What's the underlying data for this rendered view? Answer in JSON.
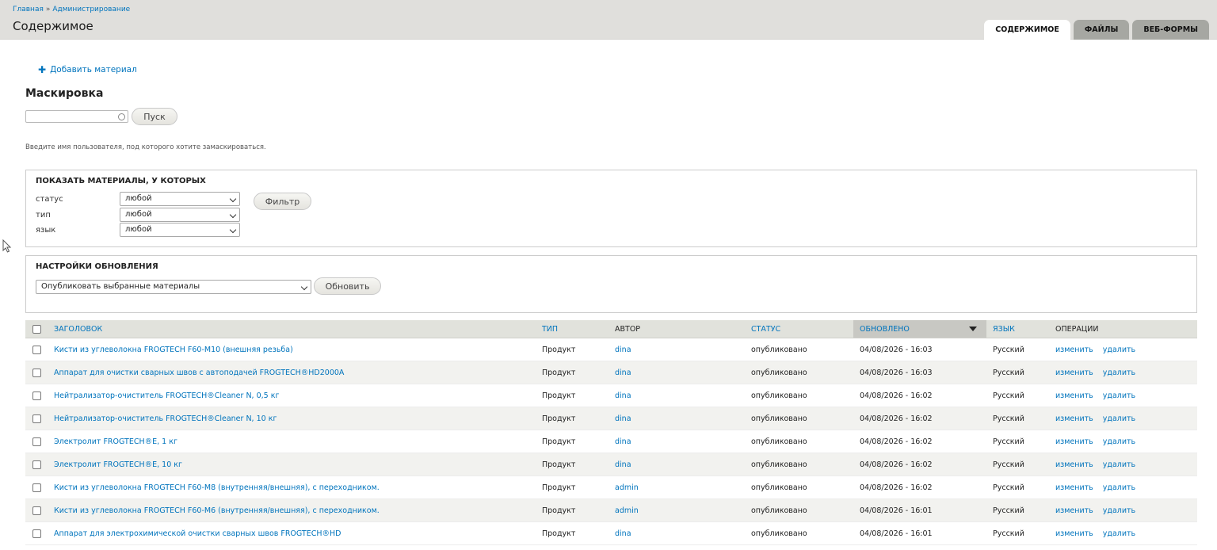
{
  "breadcrumb": {
    "items": [
      "Главная",
      "Администрирование"
    ],
    "sep": "»"
  },
  "page_title": "Содержимое",
  "tabs": [
    {
      "label": "СОДЕРЖИМОЕ",
      "active": true
    },
    {
      "label": "ФАЙЛЫ",
      "active": false
    },
    {
      "label": "ВЕБ-ФОРМЫ",
      "active": false
    }
  ],
  "add_link": {
    "icon": "plus-icon",
    "label": "Добавить материал"
  },
  "masquerade": {
    "title": "Маскировка",
    "input_value": "",
    "go_label": "Пуск",
    "description": "Введите имя пользователя, под которого хотите замаскироваться."
  },
  "filter": {
    "legend": "ПОКАЗАТЬ МАТЕРИАЛЫ, У КОТОРЫХ",
    "rows": [
      {
        "label": "статус",
        "value": "любой"
      },
      {
        "label": "тип",
        "value": "любой"
      },
      {
        "label": "язык",
        "value": "любой"
      }
    ],
    "button": "Фильтр"
  },
  "update": {
    "legend": "НАСТРОЙКИ ОБНОВЛЕНИЯ",
    "selected": "Опубликовать выбранные материалы",
    "button": "Обновить"
  },
  "table": {
    "headers": {
      "title": "ЗАГОЛОВОК",
      "type": "ТИП",
      "author": "АВТОР",
      "status": "СТАТУС",
      "updated": "ОБНОВЛЕНО",
      "lang": "ЯЗЫК",
      "ops": "ОПЕРАЦИИ"
    },
    "rows": [
      {
        "title": "Кисти из углеволокна FROGTECH F60-M10 (внешняя резьба)",
        "type": "Продукт",
        "author": "dina",
        "status": "опубликовано",
        "updated": "04/08/2026 - 16:03",
        "lang": "Русский",
        "edit": "изменить",
        "delete": "удалить"
      },
      {
        "title": "Аппарат для очистки сварных швов с автоподачей FROGTECH®HD2000A",
        "type": "Продукт",
        "author": "dina",
        "status": "опубликовано",
        "updated": "04/08/2026 - 16:03",
        "lang": "Русский",
        "edit": "изменить",
        "delete": "удалить"
      },
      {
        "title": "Нейтрализатор-очиститель FROGTECH®Cleaner N, 0,5 кг",
        "type": "Продукт",
        "author": "dina",
        "status": "опубликовано",
        "updated": "04/08/2026 - 16:02",
        "lang": "Русский",
        "edit": "изменить",
        "delete": "удалить"
      },
      {
        "title": "Нейтрализатор-очиститель FROGTECH®Cleaner N, 10 кг",
        "type": "Продукт",
        "author": "dina",
        "status": "опубликовано",
        "updated": "04/08/2026 - 16:02",
        "lang": "Русский",
        "edit": "изменить",
        "delete": "удалить"
      },
      {
        "title": "Электролит FROGTECH®E, 1 кг",
        "type": "Продукт",
        "author": "dina",
        "status": "опубликовано",
        "updated": "04/08/2026 - 16:02",
        "lang": "Русский",
        "edit": "изменить",
        "delete": "удалить"
      },
      {
        "title": "Электролит FROGTECH®E, 10 кг",
        "type": "Продукт",
        "author": "dina",
        "status": "опубликовано",
        "updated": "04/08/2026 - 16:02",
        "lang": "Русский",
        "edit": "изменить",
        "delete": "удалить"
      },
      {
        "title": "Кисти из углеволокна FROGTECH F60-M8 (внутренняя/внешняя), с переходником.",
        "type": "Продукт",
        "author": "admin",
        "status": "опубликовано",
        "updated": "04/08/2026 - 16:02",
        "lang": "Русский",
        "edit": "изменить",
        "delete": "удалить"
      },
      {
        "title": "Кисти из углеволокна FROGTECH F60-M6 (внутренняя/внешняя), с переходником.",
        "type": "Продукт",
        "author": "admin",
        "status": "опубликовано",
        "updated": "04/08/2026 - 16:01",
        "lang": "Русский",
        "edit": "изменить",
        "delete": "удалить"
      },
      {
        "title": "Аппарат для электрохимической очистки сварных швов FROGTECH®HD",
        "type": "Продукт",
        "author": "dina",
        "status": "опубликовано",
        "updated": "04/08/2026 - 16:01",
        "lang": "Русский",
        "edit": "изменить",
        "delete": "удалить"
      }
    ]
  }
}
